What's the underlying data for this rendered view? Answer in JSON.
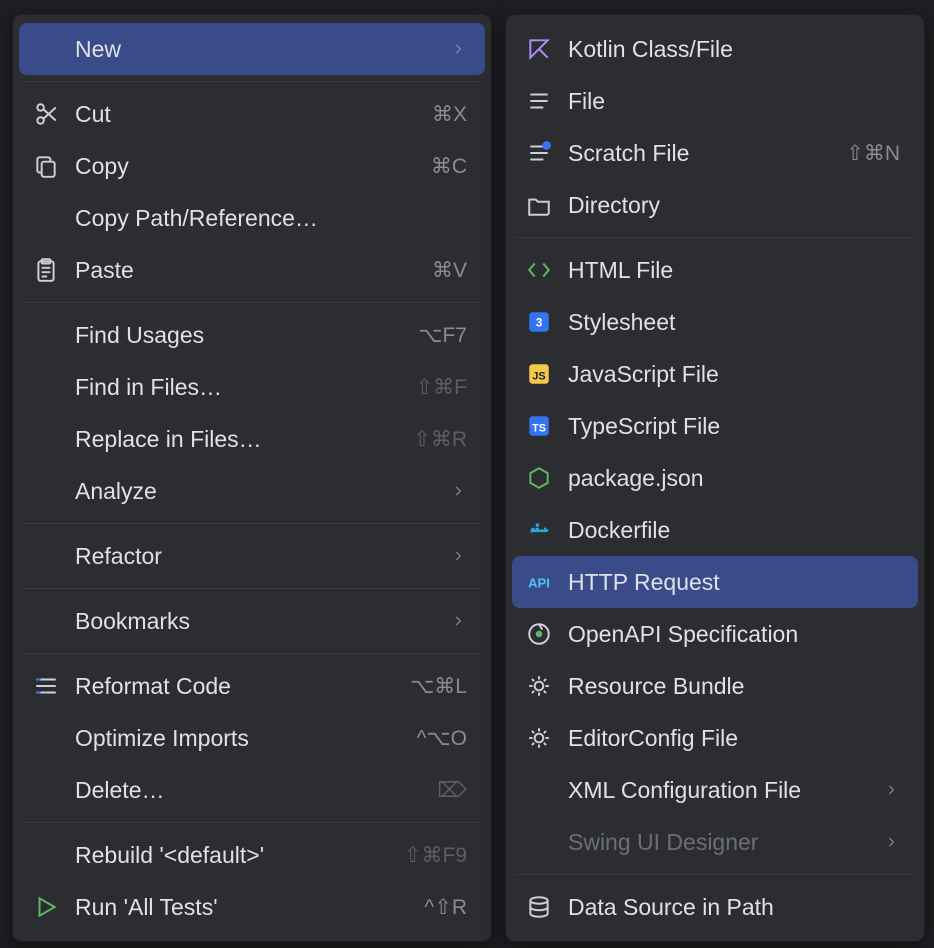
{
  "leftMenu": {
    "items": [
      {
        "label": "New",
        "chevron": true,
        "selected": true
      },
      {
        "sep": true
      },
      {
        "label": "Cut",
        "shortcut": "⌘X",
        "icon": "scissors"
      },
      {
        "label": "Copy",
        "shortcut": "⌘C",
        "icon": "copy"
      },
      {
        "label": "Copy Path/Reference…"
      },
      {
        "label": "Paste",
        "shortcut": "⌘V",
        "icon": "clipboard"
      },
      {
        "sep": true
      },
      {
        "label": "Find Usages",
        "shortcut": "⌥F7"
      },
      {
        "label": "Find in Files…",
        "shortcut": "⇧⌘F",
        "shortcutDim": true
      },
      {
        "label": "Replace in Files…",
        "shortcut": "⇧⌘R",
        "shortcutDim": true
      },
      {
        "label": "Analyze",
        "chevron": true
      },
      {
        "sep": true
      },
      {
        "label": "Refactor",
        "chevron": true
      },
      {
        "sep": true
      },
      {
        "label": "Bookmarks",
        "chevron": true
      },
      {
        "sep": true
      },
      {
        "label": "Reformat Code",
        "shortcut": "⌥⌘L",
        "icon": "reformat"
      },
      {
        "label": "Optimize Imports",
        "shortcut": "^⌥O"
      },
      {
        "label": "Delete…",
        "shortcut": "⌦",
        "shortcutDim": true
      },
      {
        "sep": true
      },
      {
        "label": "Rebuild '<default>'",
        "shortcut": "⇧⌘F9",
        "shortcutDim": true
      },
      {
        "label": "Run 'All Tests'",
        "shortcut": "^⇧R",
        "icon": "run"
      }
    ]
  },
  "rightMenu": {
    "items": [
      {
        "label": "Kotlin Class/File",
        "icon": "kotlin"
      },
      {
        "label": "File",
        "icon": "file-lines"
      },
      {
        "label": "Scratch File",
        "shortcut": "⇧⌘N",
        "icon": "scratch"
      },
      {
        "label": "Directory",
        "icon": "folder"
      },
      {
        "sep": true
      },
      {
        "label": "HTML File",
        "icon": "html"
      },
      {
        "label": "Stylesheet",
        "icon": "css"
      },
      {
        "label": "JavaScript File",
        "icon": "js"
      },
      {
        "label": "TypeScript File",
        "icon": "ts"
      },
      {
        "label": "package.json",
        "icon": "node"
      },
      {
        "label": "Dockerfile",
        "icon": "docker"
      },
      {
        "label": "HTTP Request",
        "icon": "api",
        "selected": true
      },
      {
        "label": "OpenAPI Specification",
        "icon": "openapi"
      },
      {
        "label": "Resource Bundle",
        "icon": "gear"
      },
      {
        "label": "EditorConfig File",
        "icon": "gear"
      },
      {
        "label": "XML Configuration File",
        "chevron": true
      },
      {
        "label": "Swing UI Designer",
        "chevron": true,
        "disabled": true
      },
      {
        "sep": true
      },
      {
        "label": "Data Source in Path",
        "icon": "datasource"
      }
    ]
  }
}
